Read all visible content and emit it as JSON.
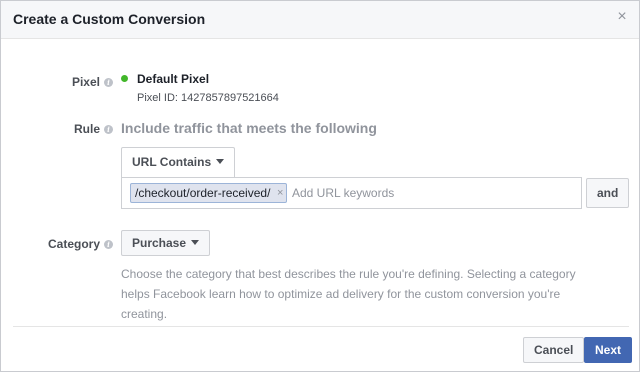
{
  "dialog": {
    "title": "Create a Custom Conversion",
    "close_glyph": "×"
  },
  "pixel": {
    "label": "Pixel",
    "name": "Default Pixel",
    "id_text": "Pixel ID: 1427857897521664",
    "status_color": "#42b72a"
  },
  "rule": {
    "label": "Rule",
    "heading": "Include traffic that meets the following",
    "condition_label": "URL Contains",
    "tokens": [
      "/checkout/order-received/"
    ],
    "token_remove_glyph": "×",
    "input_placeholder": "Add URL keywords",
    "and_label": "and"
  },
  "category": {
    "label": "Category",
    "selected": "Purchase",
    "help_text": "Choose the category that best describes the rule you're defining. Selecting a category helps Facebook learn how to optimize ad delivery for the custom conversion you're creating."
  },
  "footer": {
    "cancel_label": "Cancel",
    "next_label": "Next",
    "primary_color": "#4267b2"
  },
  "icons": {
    "info": "i"
  }
}
